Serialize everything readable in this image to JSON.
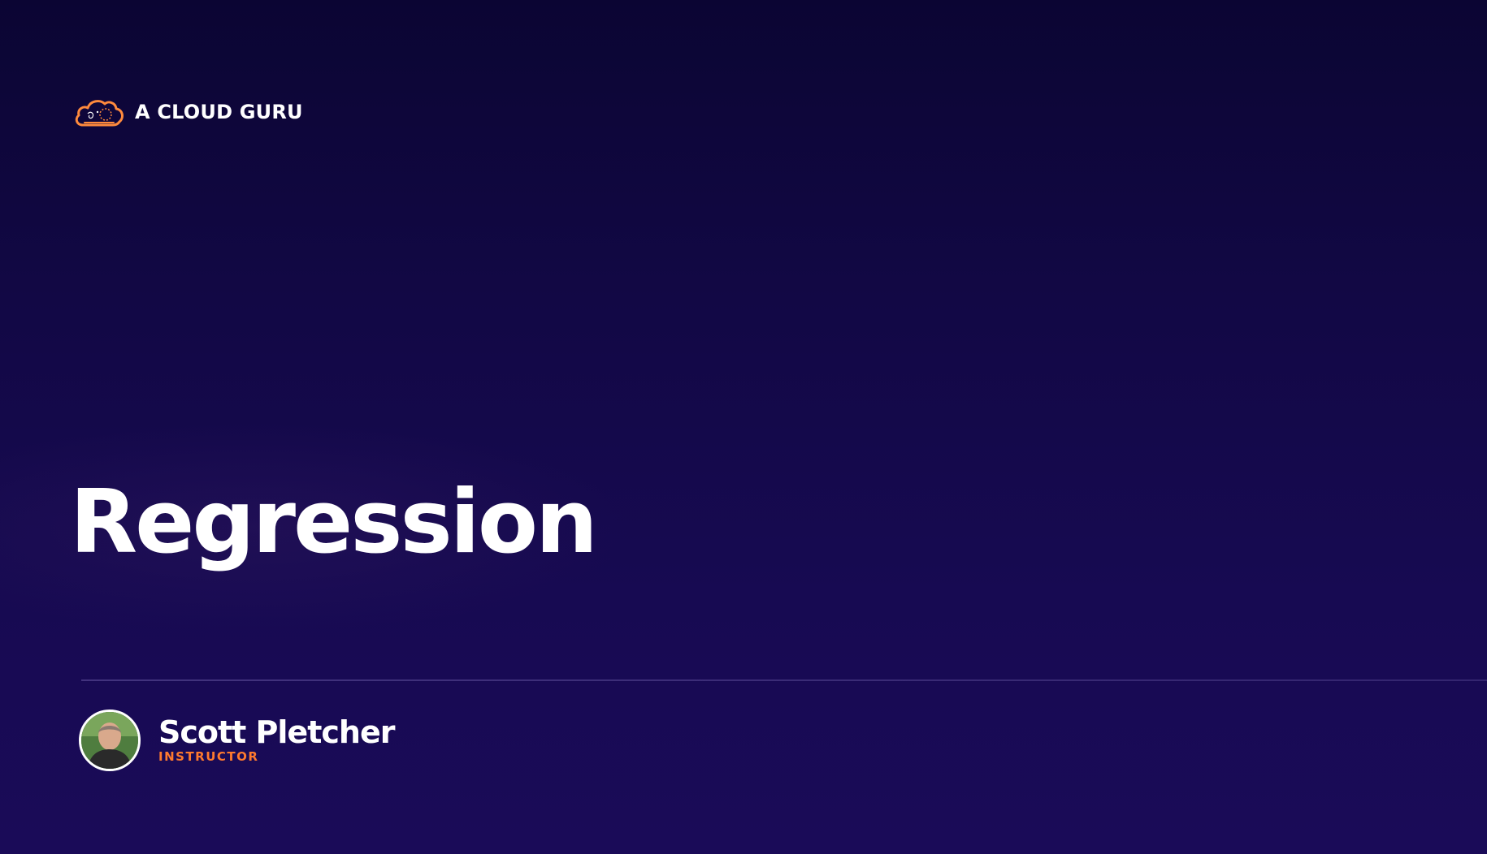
{
  "brand": {
    "name": "A CLOUD GURU",
    "icon": "cloud-logo-icon",
    "accent_color": "#ff8a3d"
  },
  "slide": {
    "title": "Regression"
  },
  "presenter": {
    "name": "Scott Pletcher",
    "role": "INSTRUCTOR",
    "role_color": "#ff7a2e"
  },
  "colors": {
    "background_top": "#0b0533",
    "background_bottom": "#1a0b58",
    "text": "#ffffff"
  }
}
